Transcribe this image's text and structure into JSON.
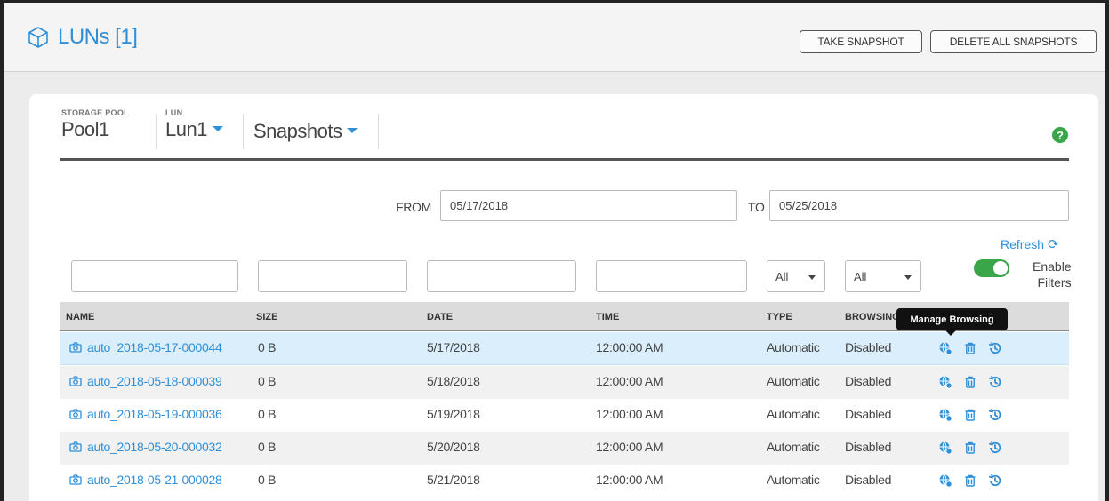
{
  "header": {
    "title": "LUNs [1]",
    "take_snapshot_label": "TAKE SNAPSHOT",
    "delete_all_label": "DELETE ALL SNAPSHOTS"
  },
  "selectors": {
    "pool_label": "STORAGE POOL",
    "pool_value": "Pool1",
    "lun_label": "LUN",
    "lun_value": "Lun1",
    "view_value": "Snapshots"
  },
  "help_label": "?",
  "date_filter": {
    "from_label": "FROM",
    "from_value": "05/17/2018",
    "to_label": "TO",
    "to_value": "05/25/2018"
  },
  "refresh_label": "Refresh",
  "filters": {
    "type_value": "All",
    "browsing_value": "All",
    "enable_label_1": "Enable",
    "enable_label_2": "Filters",
    "enabled": true
  },
  "columns": [
    "NAME",
    "SIZE",
    "DATE",
    "TIME",
    "TYPE",
    "BROWSING"
  ],
  "rows": [
    {
      "name": "auto_2018-05-17-000044",
      "size": "0 B",
      "date": "5/17/2018",
      "time": "12:00:00 AM",
      "type": "Automatic",
      "browsing": "Disabled"
    },
    {
      "name": "auto_2018-05-18-000039",
      "size": "0 B",
      "date": "5/18/2018",
      "time": "12:00:00 AM",
      "type": "Automatic",
      "browsing": "Disabled"
    },
    {
      "name": "auto_2018-05-19-000036",
      "size": "0 B",
      "date": "5/19/2018",
      "time": "12:00:00 AM",
      "type": "Automatic",
      "browsing": "Disabled"
    },
    {
      "name": "auto_2018-05-20-000032",
      "size": "0 B",
      "date": "5/20/2018",
      "time": "12:00:00 AM",
      "type": "Automatic",
      "browsing": "Disabled"
    },
    {
      "name": "auto_2018-05-21-000028",
      "size": "0 B",
      "date": "5/21/2018",
      "time": "12:00:00 AM",
      "type": "Automatic",
      "browsing": "Disabled"
    }
  ],
  "tooltip": "Manage Browsing",
  "colors": {
    "accent": "#2f8fd8",
    "toggle_on": "#3aa64a",
    "highlight_row": "#dbeefb"
  }
}
